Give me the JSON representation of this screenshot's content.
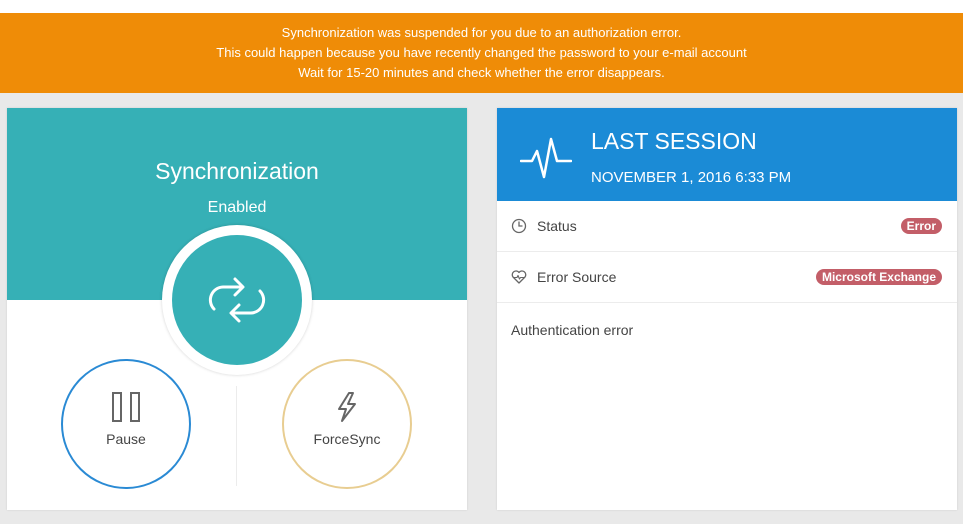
{
  "banner": {
    "line1": "Synchronization was suspended for you due to an authorization error.",
    "line2": "This could happen because you have recently changed the password to your e-mail account",
    "line3": "Wait for 15-20 minutes and check whether the error disappears.",
    "color": "#ef8c07"
  },
  "sync": {
    "title": "Synchronization",
    "state": "Enabled",
    "icon": "sync-arrows-icon",
    "color": "#36b0b6",
    "pause_label": "Pause",
    "pause_icon": "pause-icon",
    "force_label": "ForceSync",
    "force_icon": "lightning-icon"
  },
  "session": {
    "title": "LAST SESSION",
    "date": "NOVEMBER 1, 2016 6:33 PM",
    "icon": "pulse-icon",
    "color": "#1b8bd6",
    "status_label": "Status",
    "status_icon": "clock-icon",
    "status_value": "Error",
    "source_label": "Error Source",
    "source_icon": "heartbeat-icon",
    "source_value": "Microsoft Exchange",
    "detail": "Authentication error",
    "badge_color": "#c35e68"
  }
}
